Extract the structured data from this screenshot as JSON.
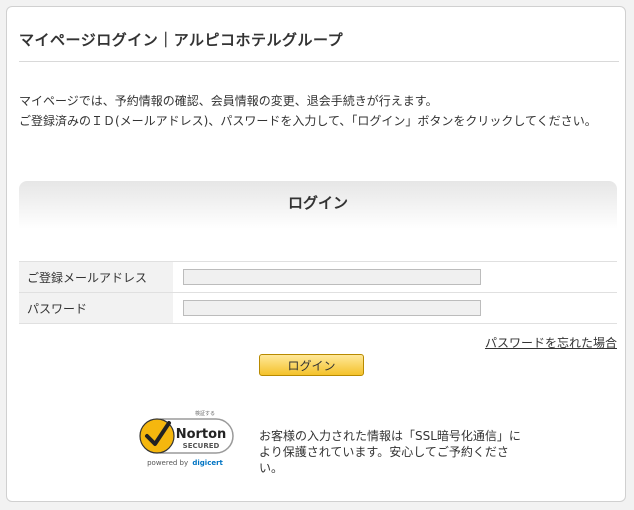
{
  "page": {
    "title": "マイページログイン｜アルピコホテルグループ",
    "description_line1": "マイページでは、予約情報の確認、会員情報の変更、退会手続きが行えます。",
    "description_line2": "ご登録済みのＩＤ(メールアドレス)、パスワードを入力して、「ログイン」ボタンをクリックしてください。"
  },
  "login": {
    "section_title": "ログイン",
    "email_label": "ご登録メールアドレス",
    "email_value": "",
    "password_label": "パスワード",
    "password_value": "",
    "forgot_password_link": "パスワードを忘れた場合",
    "submit_label": "ログイン"
  },
  "security": {
    "badge_top": "検証する",
    "badge_name": "Norton",
    "badge_secured": "SECURED",
    "badge_powered": "powered by",
    "badge_brand": "digicert",
    "ssl_notice": "お客様の入力された情報は「SSL暗号化通信」により保護されています。安心してご予約ください。"
  },
  "colors": {
    "button_top": "#ffe89a",
    "button_bottom": "#f4c22b",
    "norton_yellow": "#f5b70e",
    "digicert_blue": "#0174c3"
  }
}
